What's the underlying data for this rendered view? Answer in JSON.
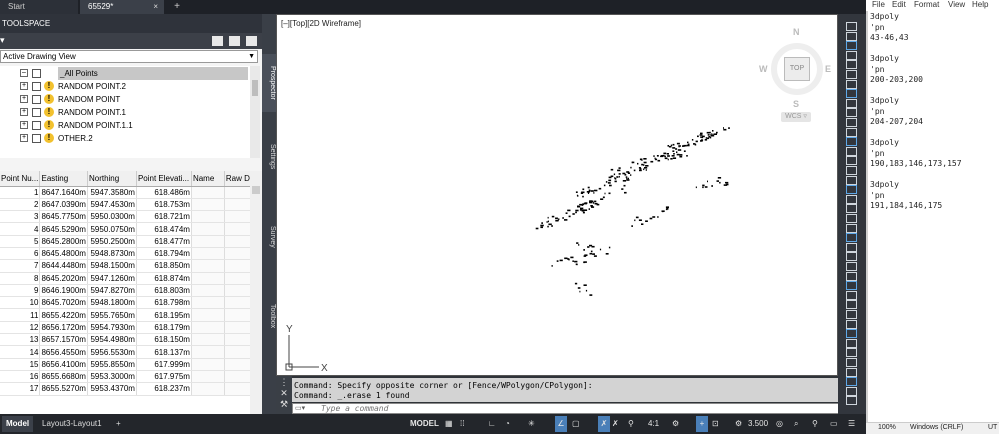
{
  "tabs": [
    {
      "label": "Start"
    },
    {
      "label": "65529*",
      "close": "×"
    }
  ],
  "tab_add": "+",
  "toolspace": {
    "title": "TOOLSPACE",
    "view_selector": "Active Drawing View",
    "tree": [
      {
        "label": "_All Points",
        "selected": true
      },
      {
        "label": "RANDOM POINT.2"
      },
      {
        "label": "RANDOM POINT"
      },
      {
        "label": "RANDOM POINT.1"
      },
      {
        "label": "RANDOM POINT.1.1"
      },
      {
        "label": "OTHER.2"
      }
    ],
    "side_tabs": [
      "Prospector",
      "Settings",
      "Survey",
      "Toolbox"
    ],
    "grid": {
      "columns": [
        "Point Nu...",
        "Easting",
        "Northing",
        "Point Elevati...",
        "Name",
        "Raw De..."
      ],
      "rows": [
        [
          "1",
          "8647.1640m",
          "5947.3580m",
          "618.486m"
        ],
        [
          "2",
          "8647.0390m",
          "5947.4530m",
          "618.753m"
        ],
        [
          "3",
          "8645.7750m",
          "5950.0300m",
          "618.721m"
        ],
        [
          "4",
          "8645.5290m",
          "5950.0750m",
          "618.474m"
        ],
        [
          "5",
          "8645.2800m",
          "5950.2500m",
          "618.477m"
        ],
        [
          "6",
          "8645.4800m",
          "5948.8730m",
          "618.794m"
        ],
        [
          "7",
          "8644.4480m",
          "5948.1500m",
          "618.850m"
        ],
        [
          "8",
          "8645.2020m",
          "5947.1260m",
          "618.874m"
        ],
        [
          "9",
          "8646.1900m",
          "5947.8270m",
          "618.803m"
        ],
        [
          "10",
          "8645.7020m",
          "5948.1800m",
          "618.798m"
        ],
        [
          "11",
          "8655.4220m",
          "5955.7650m",
          "618.195m"
        ],
        [
          "12",
          "8656.1720m",
          "5954.7930m",
          "618.179m"
        ],
        [
          "13",
          "8657.1570m",
          "5954.4980m",
          "618.150m"
        ],
        [
          "14",
          "8656.4550m",
          "5956.5530m",
          "618.137m"
        ],
        [
          "15",
          "8656.4100m",
          "5955.8550m",
          "617.999m"
        ],
        [
          "16",
          "8655.6680m",
          "5953.3000m",
          "617.975m"
        ],
        [
          "17",
          "8655.5270m",
          "5953.4370m",
          "618.237m"
        ]
      ]
    }
  },
  "viewport": {
    "label": "[–][Top][2D Wireframe]",
    "viewcube": {
      "n": "N",
      "s": "S",
      "e": "E",
      "w": "W",
      "top": "TOP",
      "wcs": "WCS ▿"
    },
    "ucs": {
      "x": "X",
      "y": "Y"
    }
  },
  "command": {
    "history": [
      "Command: Specify opposite corner or [Fence/WPolygon/CPolygon]:",
      "Command: _.erase 1 found"
    ],
    "placeholder": "Type a command"
  },
  "statusbar": {
    "tabs": [
      "Model",
      "Layout3-Layout1"
    ],
    "add": "+",
    "model": "MODEL",
    "scale": "4:1",
    "lineweight": "3.500"
  },
  "notepad": {
    "menu": [
      "File",
      "Edit",
      "Format",
      "View",
      "Help"
    ],
    "text": "3dpoly\n'pn\n43-46,43\n\n3dpoly\n'pn\n200-203,200\n\n3dpoly\n'pn\n204-207,204\n\n3dpoly\n'pn\n190,183,146,173,157\n\n3dpoly\n'pn\n191,184,146,175",
    "status": {
      "zoom": "100%",
      "eol": "Windows (CRLF)",
      "enc": "UT"
    }
  },
  "colors": {
    "accent": "#0a7ac2",
    "tree_icon": "#f2c12e",
    "canvas": "#ffffff"
  }
}
